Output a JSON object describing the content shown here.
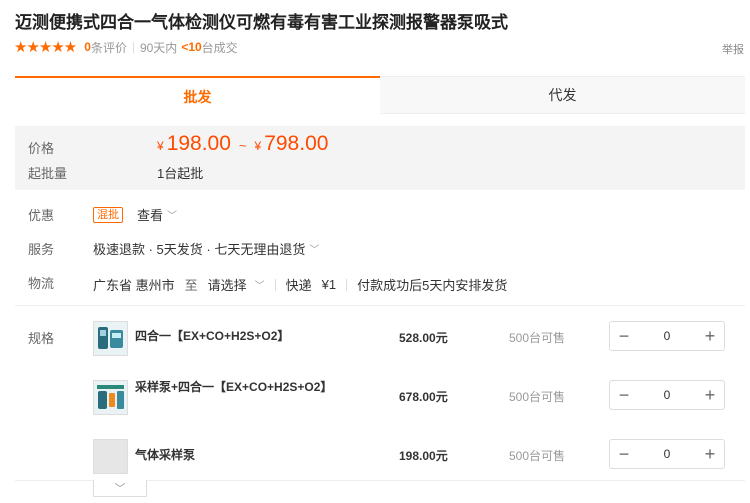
{
  "product": {
    "title": "迈测便携式四合一气体检测仪可燃有毒有害工业探测报警器泵吸式",
    "stars": "★★★★★",
    "review_count": "0",
    "review_label": "条评价",
    "period_label": "90天内",
    "deal_count": "<10",
    "deal_label": "台成交",
    "report_label": "举报"
  },
  "tabs": {
    "wholesale": "批发",
    "dropship": "代发"
  },
  "price": {
    "label": "价格",
    "currency": "¥",
    "min": "198.00",
    "tilde": "~",
    "max": "798.00",
    "moq_label": "起批量",
    "moq_value": "1台起批"
  },
  "discount": {
    "label": "优惠",
    "badge": "混批",
    "view": "查看"
  },
  "service": {
    "label": "服务",
    "value": "极速退款 · 5天发货 · 七天无理由退货"
  },
  "logistics": {
    "label": "物流",
    "origin": "广东省 惠州市",
    "to": "至",
    "destination": "请选择",
    "method": "快递",
    "fee": "¥1",
    "note": "付款成功后5天内安排发货"
  },
  "specs": {
    "label": "规格",
    "items": [
      {
        "name": "四合一【EX+CO+H2S+O2】",
        "price": "528.00元",
        "stock": "500台可售",
        "qty": "0"
      },
      {
        "name": "采样泵+四合一【EX+CO+H2S+O2】",
        "price": "678.00元",
        "stock": "500台可售",
        "qty": "0"
      },
      {
        "name": "气体采样泵",
        "price": "198.00元",
        "stock": "500台可售",
        "qty": "0"
      }
    ],
    "minus": "−",
    "plus": "+",
    "expand": "﹀"
  },
  "colors": {
    "accent": "#ff6a00",
    "price": "#ff4a00"
  }
}
